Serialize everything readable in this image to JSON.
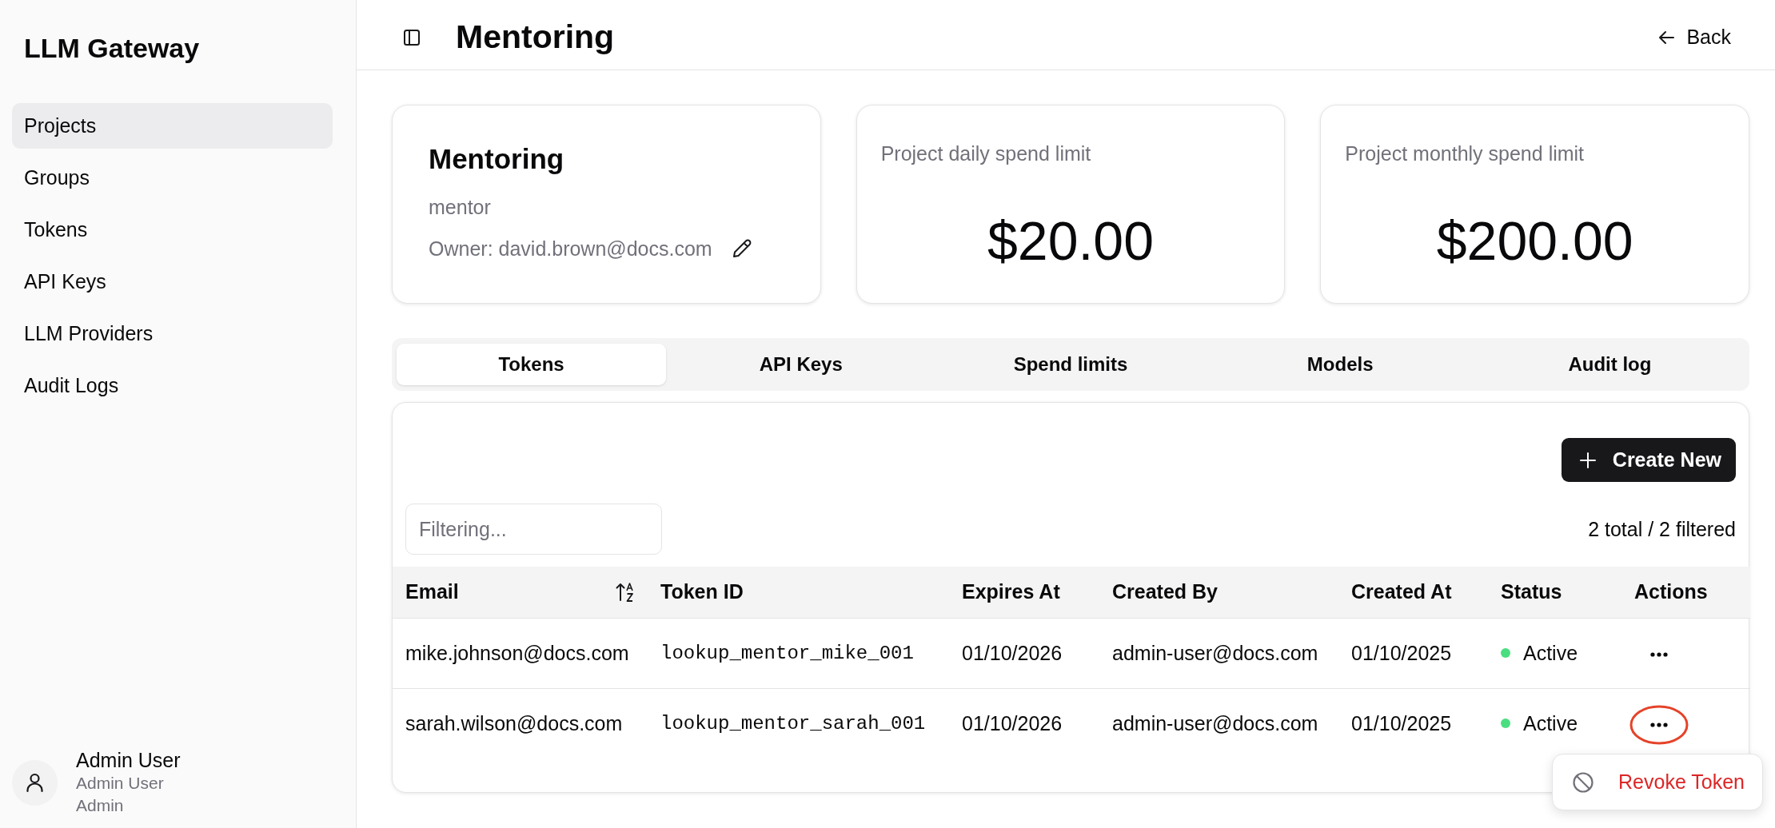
{
  "sidebar": {
    "title": "LLM Gateway",
    "items": [
      {
        "label": "Projects",
        "selected": true
      },
      {
        "label": "Groups",
        "selected": false
      },
      {
        "label": "Tokens",
        "selected": false
      },
      {
        "label": "API Keys",
        "selected": false
      },
      {
        "label": "LLM Providers",
        "selected": false
      },
      {
        "label": "Audit Logs",
        "selected": false
      }
    ],
    "user": {
      "name": "Admin User",
      "subtitle": "Admin User",
      "role": "Admin"
    }
  },
  "header": {
    "title": "Mentoring",
    "back": "Back"
  },
  "project_card": {
    "name": "Mentoring",
    "slug": "mentor",
    "owner": "Owner: david.brown@docs.com"
  },
  "limit_cards": [
    {
      "label": "Project daily spend limit",
      "value": "$20.00"
    },
    {
      "label": "Project monthly spend limit",
      "value": "$200.00"
    }
  ],
  "tabs": [
    {
      "label": "Tokens",
      "selected": true
    },
    {
      "label": "API Keys",
      "selected": false
    },
    {
      "label": "Spend limits",
      "selected": false
    },
    {
      "label": "Models",
      "selected": false
    },
    {
      "label": "Audit log",
      "selected": false
    }
  ],
  "tokens": {
    "create_button": "Create New",
    "filter": {
      "placeholder": "Filtering..."
    },
    "count": "2 total / 2 filtered",
    "columns": [
      {
        "label": "Email",
        "sorted": true
      },
      {
        "label": "Token ID",
        "sorted": false
      },
      {
        "label": "Expires At",
        "sorted": false
      },
      {
        "label": "Created By",
        "sorted": false
      },
      {
        "label": "Created At",
        "sorted": false
      },
      {
        "label": "Status",
        "sorted": false
      },
      {
        "label": "Actions",
        "sorted": false
      }
    ],
    "rows": [
      {
        "email": "mike.johnson@docs.com",
        "token_id": "lookup_mentor_mike_001",
        "expires_at": "01/10/2026",
        "created_by": "admin-user@docs.com",
        "created_at": "01/10/2025",
        "status": {
          "label": "Active",
          "color": "#4ade80"
        },
        "highlighted": false
      },
      {
        "email": "sarah.wilson@docs.com",
        "token_id": "lookup_mentor_sarah_001",
        "expires_at": "01/10/2026",
        "created_by": "admin-user@docs.com",
        "created_at": "01/10/2025",
        "status": {
          "label": "Active",
          "color": "#4ade80"
        },
        "highlighted": true
      }
    ],
    "menu": {
      "items": [
        {
          "label": "Revoke Token"
        }
      ]
    }
  }
}
